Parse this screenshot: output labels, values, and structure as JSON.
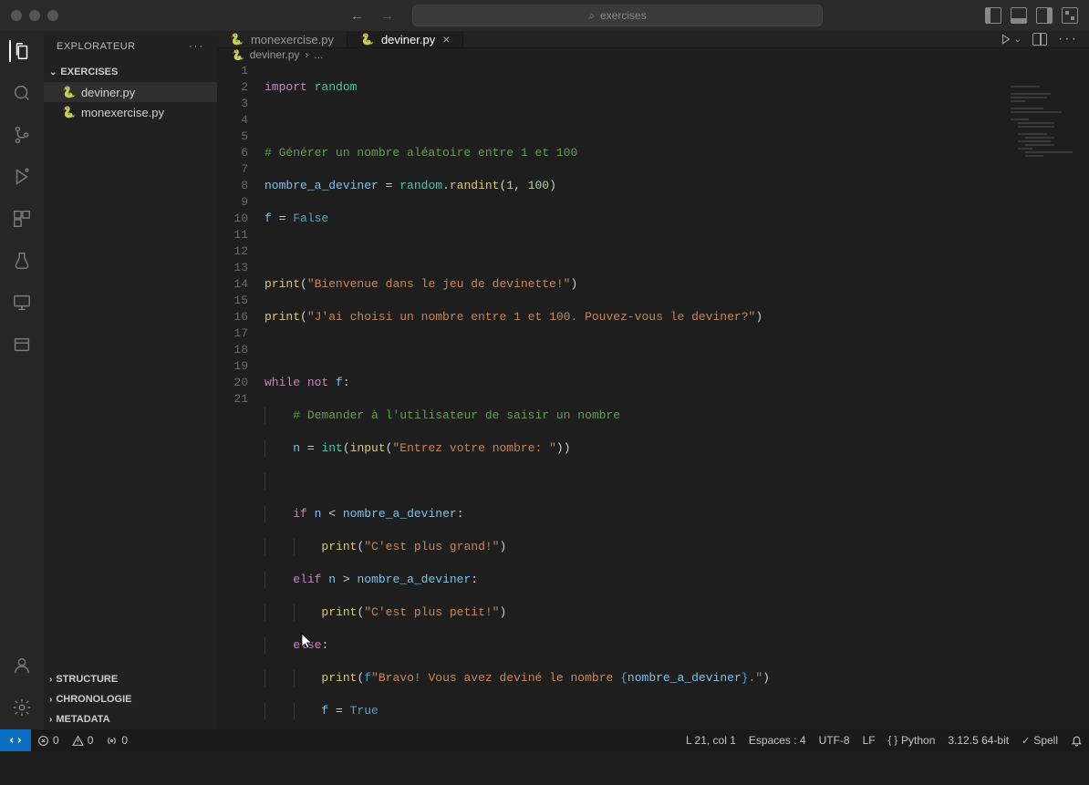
{
  "search_placeholder": "exercises",
  "sidebar": {
    "title": "EXPLORATEUR",
    "folder": "EXERCISES",
    "files": [
      "deviner.py",
      "monexercise.py"
    ],
    "bottom_sections": [
      "STRUCTURE",
      "CHRONOLOGIE",
      "METADATA"
    ]
  },
  "tabs": [
    {
      "label": "monexercise.py",
      "active": false,
      "close": false
    },
    {
      "label": "deviner.py",
      "active": true,
      "close": true
    }
  ],
  "breadcrumb": {
    "file": "deviner.py",
    "sep": "›",
    "rest": "..."
  },
  "code_lines": 21,
  "code": {
    "l1": {
      "kw_import": "import",
      "mod": "random"
    },
    "l3_comment": "# Générer un nombre aléatoire entre 1 et 100",
    "l4": {
      "var": "nombre_a_deviner",
      "eq": " = ",
      "mod": "random",
      "dot": ".",
      "fn": "randint",
      "args_open": "(",
      "n1": "1",
      "comma": ", ",
      "n2": "100",
      "args_close": ")"
    },
    "l5": {
      "var": "f",
      "eq": " = ",
      "val": "False"
    },
    "l7": {
      "fn": "print",
      "open": "(",
      "str": "\"Bienvenue dans le jeu de devinette!\"",
      "close": ")"
    },
    "l8": {
      "fn": "print",
      "open": "(",
      "str": "\"J'ai choisi un nombre entre 1 et 100. Pouvez-vous le deviner?\"",
      "close": ")"
    },
    "l10": {
      "kw_while": "while",
      "kw_not": "not",
      "var": "f",
      "colon": ":"
    },
    "l11_comment": "# Demander à l'utilisateur de saisir un nombre",
    "l12": {
      "var": "n",
      "eq": " = ",
      "fn_int": "int",
      "open1": "(",
      "fn_input": "input",
      "open2": "(",
      "str": "\"Entrez votre nombre: \"",
      "close": "))"
    },
    "l14": {
      "kw": "if",
      "var": "n",
      "op": " < ",
      "var2": "nombre_a_deviner",
      "colon": ":"
    },
    "l15": {
      "fn": "print",
      "open": "(",
      "str": "\"C'est plus grand!\"",
      "close": ")"
    },
    "l16": {
      "kw": "elif",
      "var": "n",
      "op": " > ",
      "var2": "nombre_a_deviner",
      "colon": ":"
    },
    "l17": {
      "fn": "print",
      "open": "(",
      "str": "\"C'est plus petit!\"",
      "close": ")"
    },
    "l18": {
      "kw": "else",
      "colon": ":"
    },
    "l19": {
      "fn": "print",
      "open": "(",
      "pfx": "f",
      "str1": "\"Bravo! Vous avez deviné le nombre ",
      "brace_l": "{",
      "var": "nombre_a_deviner",
      "brace_r": "}",
      "str2": ".\"",
      "close": ")"
    },
    "l20": {
      "var": "f",
      "eq": " = ",
      "val": "True"
    }
  },
  "status": {
    "errors": "0",
    "warnings": "0",
    "ports": "0",
    "cursor": "L 21, col 1",
    "spaces": "Espaces : 4",
    "encoding": "UTF-8",
    "eol": "LF",
    "language": "Python",
    "version": "3.12.5 64-bit",
    "spell": "Spell"
  }
}
